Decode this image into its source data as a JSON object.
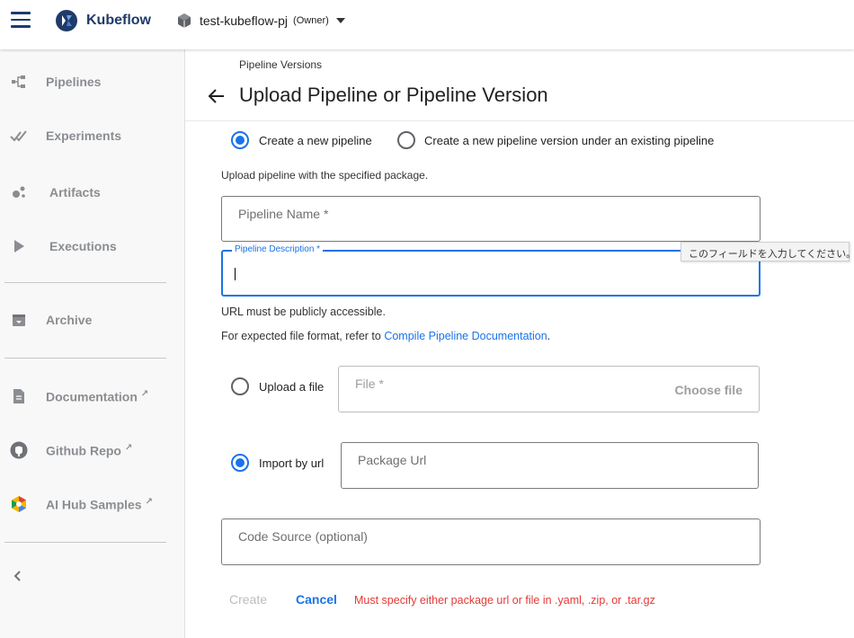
{
  "header": {
    "brand": "Kubeflow",
    "project_name": "test-kubeflow-pj",
    "project_role": "(Owner)"
  },
  "sidebar": {
    "items": [
      {
        "label": "Pipelines",
        "icon": "pipelines-icon"
      },
      {
        "label": "Experiments",
        "icon": "experiments-icon"
      },
      {
        "label": "Artifacts",
        "icon": "artifacts-icon"
      },
      {
        "label": "Executions",
        "icon": "executions-icon"
      },
      {
        "label": "Archive",
        "icon": "archive-icon"
      },
      {
        "label": "Documentation",
        "icon": "documentation-icon"
      },
      {
        "label": "Github Repo",
        "icon": "github-icon"
      },
      {
        "label": "AI Hub Samples",
        "icon": "ai-hub-icon"
      }
    ]
  },
  "page": {
    "breadcrumb": "Pipeline Versions",
    "title": "Upload Pipeline or Pipeline Version"
  },
  "form": {
    "mode_new_pipeline": "Create a new pipeline",
    "mode_new_version": "Create a new pipeline version under an existing pipeline",
    "selected_mode": "new_pipeline",
    "upload_hint": "Upload pipeline with the specified package.",
    "pipeline_name_label": "Pipeline Name *",
    "pipeline_name_value": "",
    "pipeline_description_label": "Pipeline Description *",
    "pipeline_description_value": "",
    "validation_tooltip": "このフィールドを入力してください。",
    "url_hint": "URL must be publicly accessible.",
    "format_hint_prefix": "For expected file format, refer to ",
    "format_hint_link": "Compile Pipeline Documentation",
    "format_hint_suffix": ".",
    "upload_file_label": "Upload a file",
    "file_field_label": "File *",
    "choose_file_label": "Choose file",
    "import_url_label": "Import by url",
    "package_url_label": "Package Url",
    "package_url_value": "",
    "selected_source": "import_by_url",
    "code_source_label": "Code Source (optional)",
    "code_source_value": ""
  },
  "actions": {
    "create_label": "Create",
    "cancel_label": "Cancel",
    "error_message": "Must specify either package url or file in .yaml, .zip, or .tar.gz"
  },
  "colors": {
    "accent": "#1a73e8",
    "brand_dark": "#1f3b68",
    "error": "#e53935"
  }
}
